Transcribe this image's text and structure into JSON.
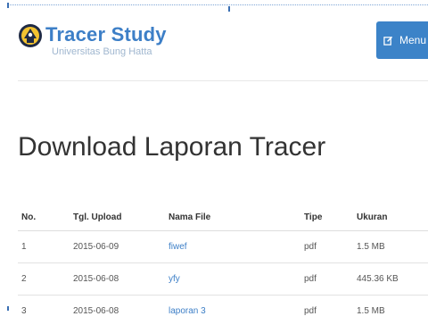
{
  "brand": {
    "title": "Tracer Study",
    "subtitle": "Universitas Bung Hatta"
  },
  "header": {
    "menu_label": "Menu",
    "menu_icon": "edit-icon"
  },
  "page": {
    "title": "Download Laporan Tracer"
  },
  "table": {
    "columns": [
      "No.",
      "Tgl. Upload",
      "Nama File",
      "Tipe",
      "Ukuran"
    ],
    "rows": [
      {
        "no": "1",
        "date": "2015-06-09",
        "name": "fiwef",
        "type": "pdf",
        "size": "1.5 MB"
      },
      {
        "no": "2",
        "date": "2015-06-08",
        "name": "yfy",
        "type": "pdf",
        "size": "445.36 KB"
      },
      {
        "no": "3",
        "date": "2015-06-08",
        "name": "laporan 3",
        "type": "pdf",
        "size": "1.5 MB"
      }
    ]
  },
  "colors": {
    "accent": "#3c83c8",
    "brand_text": "#3d7fc7",
    "subtitle_text": "#9fb6cf"
  }
}
